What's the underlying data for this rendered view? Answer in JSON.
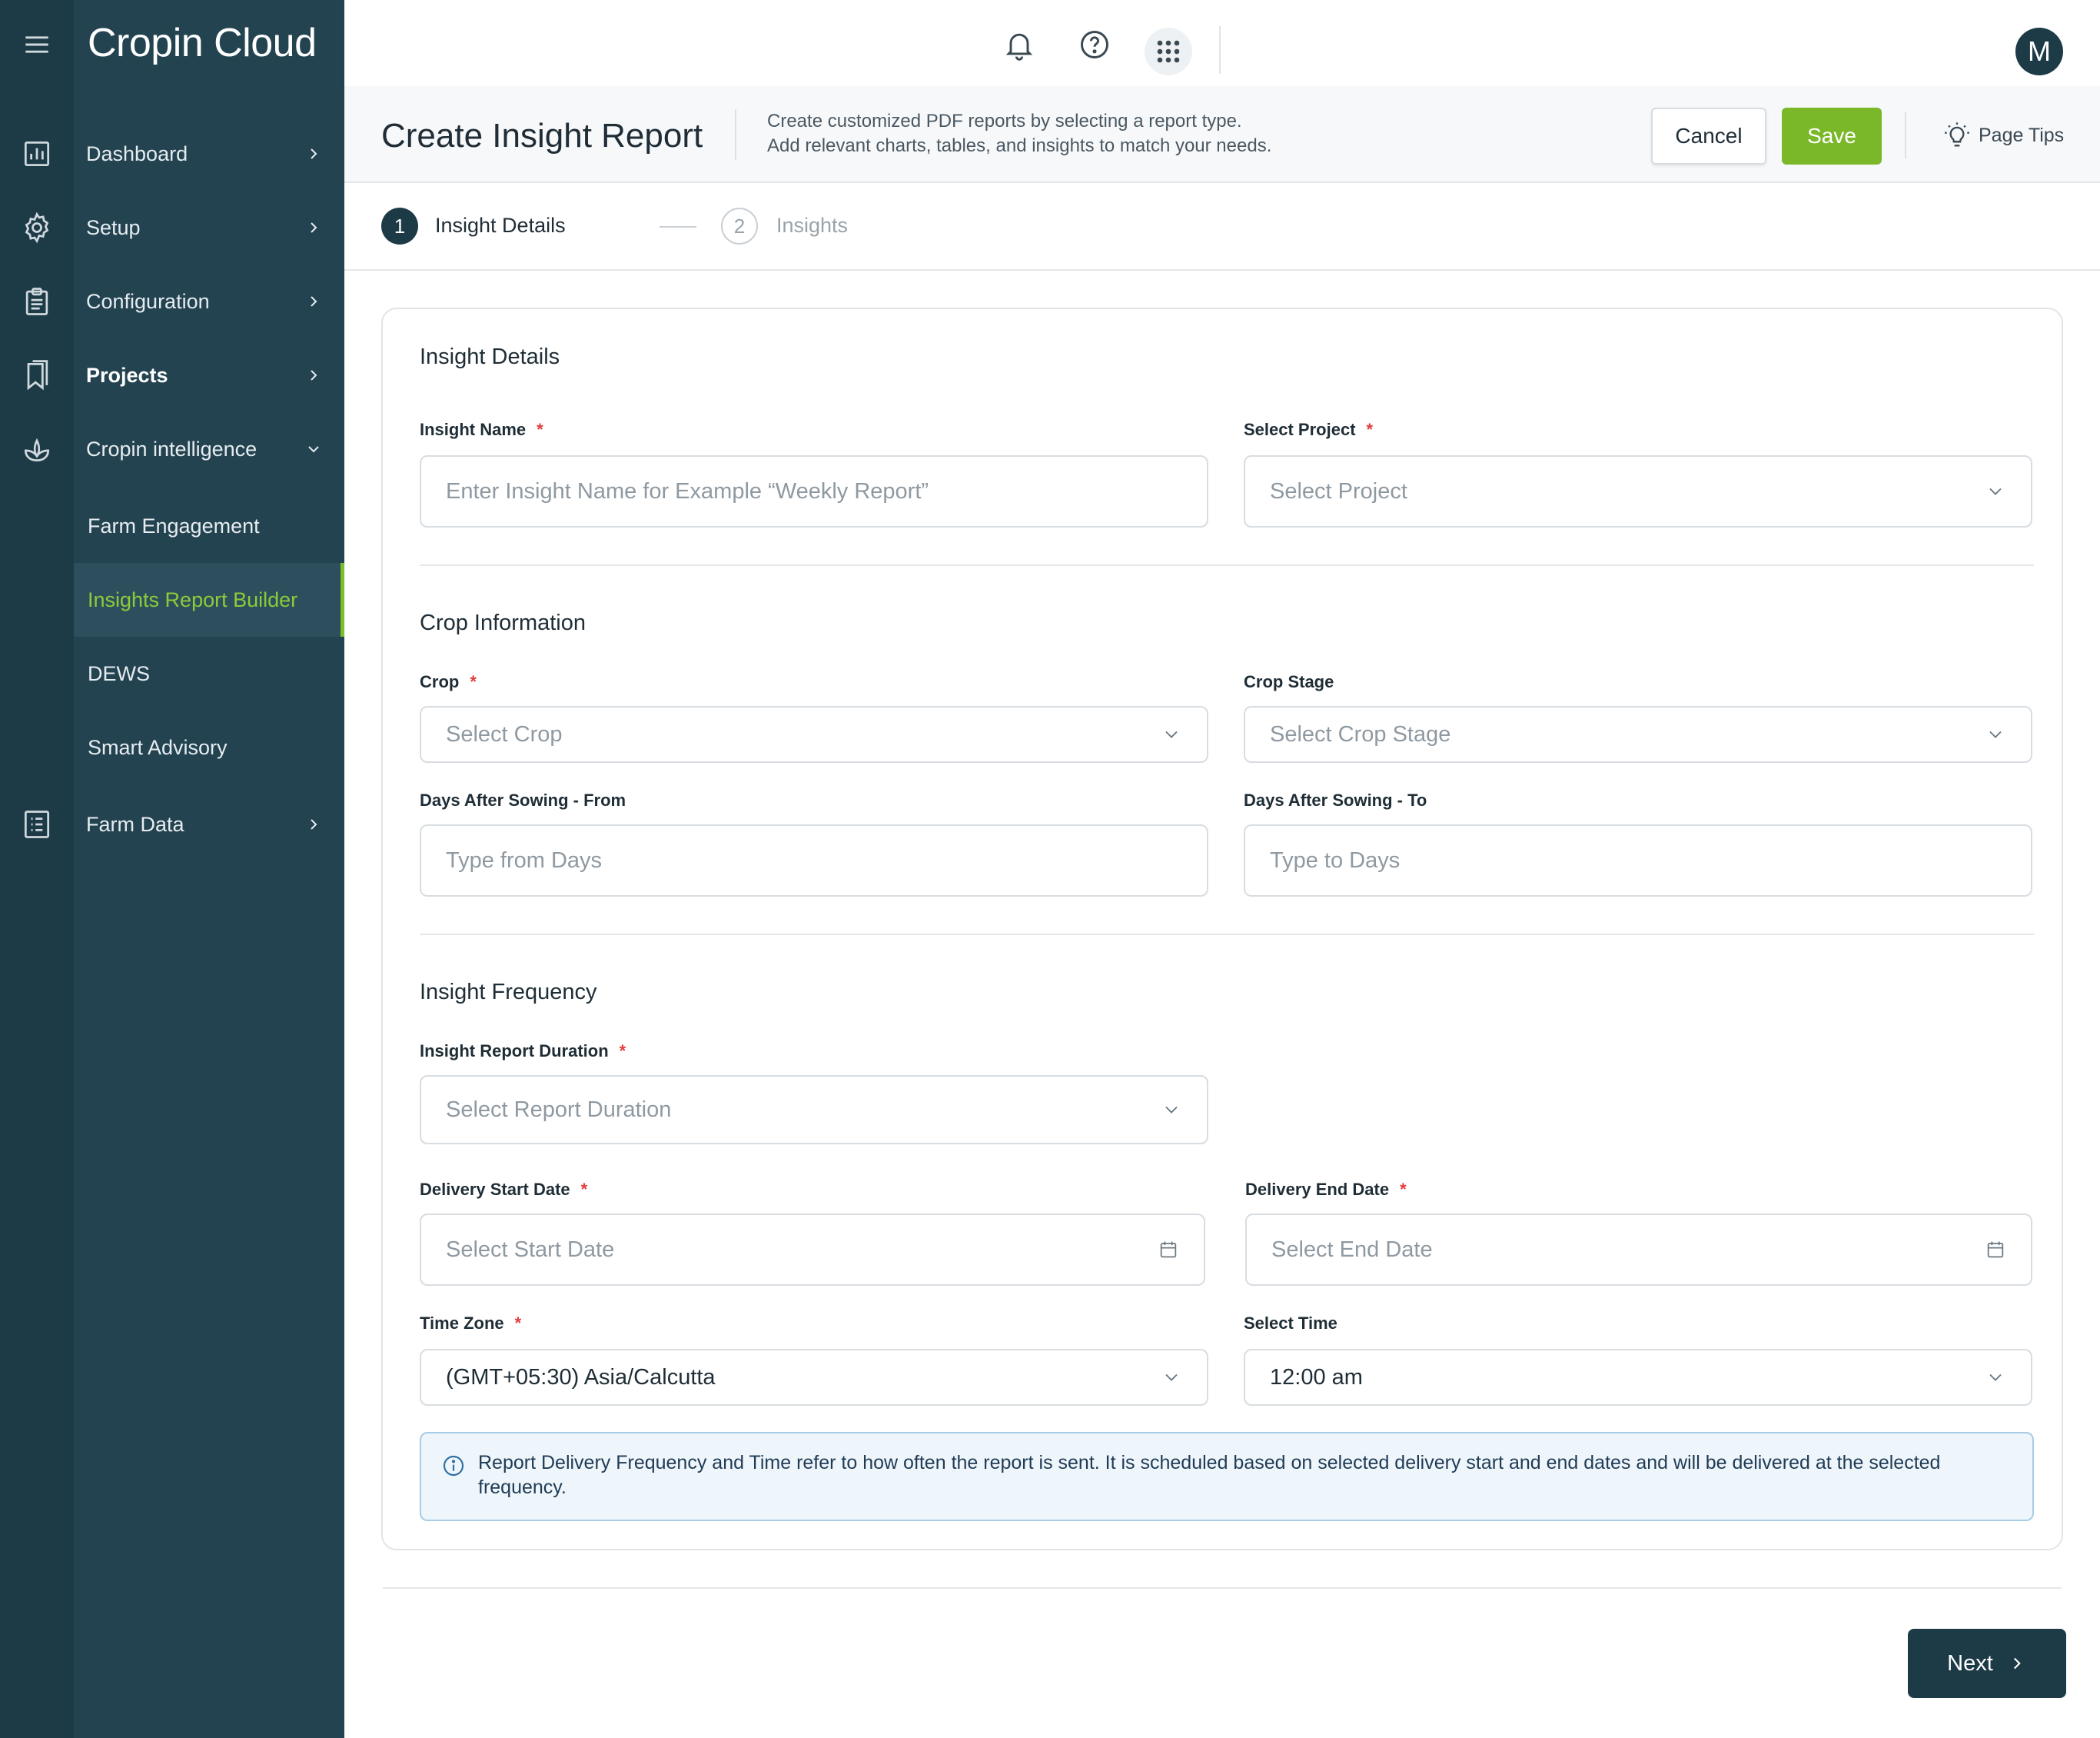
{
  "app": {
    "logo": "Cropin Cloud"
  },
  "sidebar": {
    "items": [
      {
        "label": "Dashboard"
      },
      {
        "label": "Setup"
      },
      {
        "label": "Configuration"
      },
      {
        "label": "Projects"
      },
      {
        "label": "Cropin intelligence"
      },
      {
        "label": "Farm Data"
      }
    ],
    "subitems": [
      {
        "label": "Farm Engagement"
      },
      {
        "label": "Insights Report Builder"
      },
      {
        "label": "DEWS"
      },
      {
        "label": "Smart Advisory"
      }
    ]
  },
  "topbar": {
    "avatar_initial": "M"
  },
  "header": {
    "title": "Create Insight Report",
    "desc_line1": "Create customized PDF reports by selecting a report type.",
    "desc_line2": "Add relevant charts, tables, and insights to match your needs.",
    "cancel_label": "Cancel",
    "save_label": "Save",
    "page_tips_label": "Page Tips"
  },
  "stepper": {
    "step1_num": "1",
    "step1_label": "Insight Details",
    "step2_num": "2",
    "step2_label": "Insights"
  },
  "form": {
    "section1_title": "Insight Details",
    "insight_name_label": "Insight Name",
    "insight_name_placeholder": "Enter Insight Name for Example “Weekly Report”",
    "select_project_label": "Select Project",
    "select_project_placeholder": "Select Project",
    "section2_title": "Crop Information",
    "crop_label": "Crop",
    "crop_placeholder": "Select Crop",
    "crop_stage_label": "Crop Stage",
    "crop_stage_placeholder": "Select Crop Stage",
    "das_from_label": "Days After Sowing - From",
    "das_from_placeholder": "Type from Days",
    "das_to_label": "Days After Sowing - To",
    "das_to_placeholder": "Type to Days",
    "section3_title": "Insight Frequency",
    "duration_label": "Insight Report Duration",
    "duration_placeholder": "Select Report Duration",
    "start_date_label": "Delivery Start Date",
    "start_date_placeholder": "Select Start Date",
    "end_date_label": "Delivery End Date",
    "end_date_placeholder": "Select End Date",
    "timezone_label": "Time Zone",
    "timezone_value": "(GMT+05:30) Asia/Calcutta",
    "time_label": "Select Time",
    "time_value": "12:00 am",
    "required_mark": "*",
    "info_text": "Report Delivery Frequency and Time refer to how often the report is sent. It is scheduled based on selected delivery start and end dates and will be delivered at the selected frequency."
  },
  "footer": {
    "next_label": "Next"
  }
}
